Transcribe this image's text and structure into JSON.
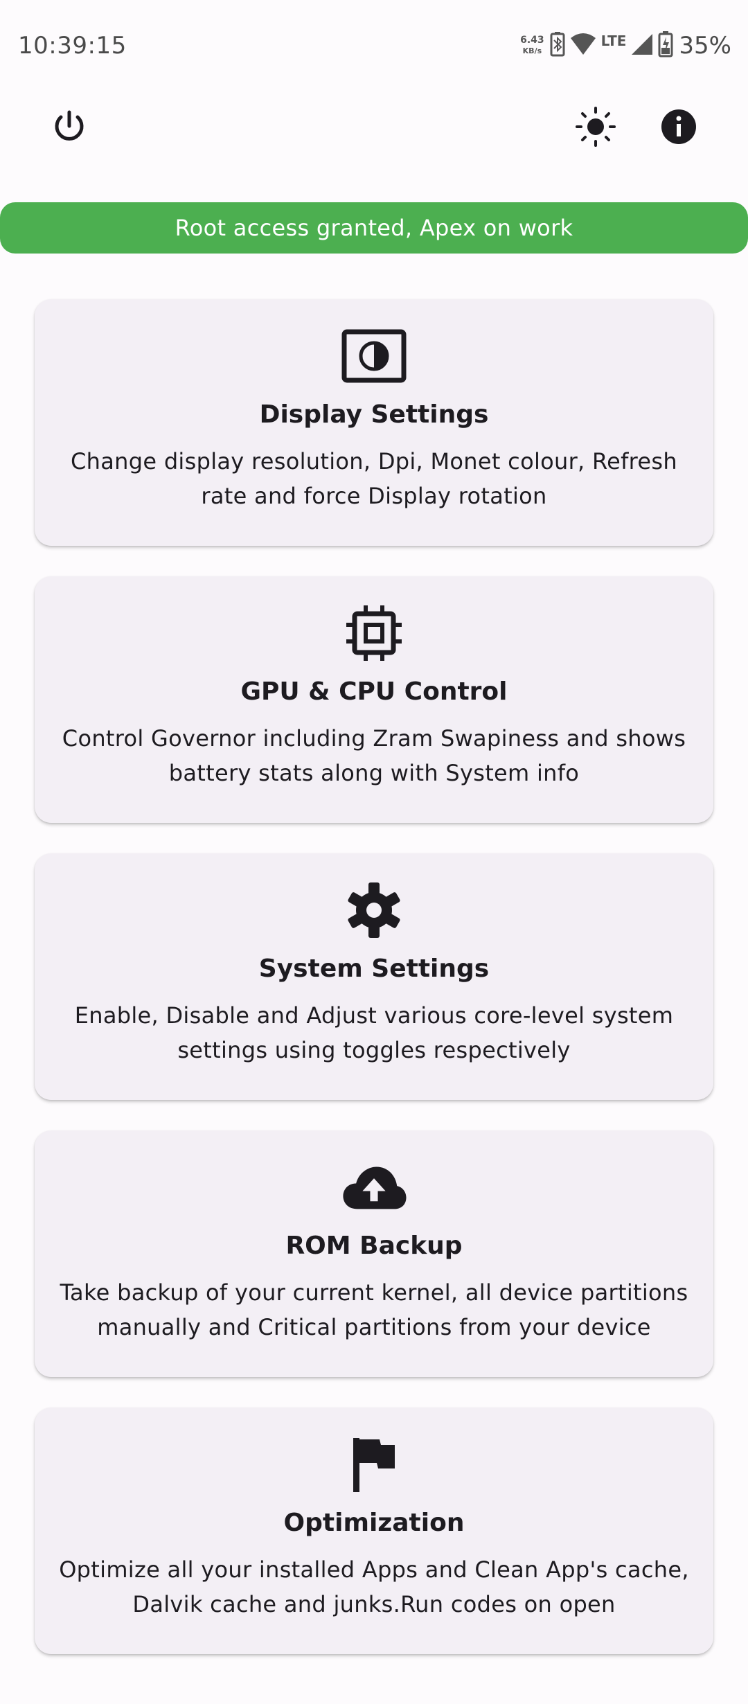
{
  "status_bar": {
    "time": "10:39:15",
    "net_speed_value": "6.43",
    "net_speed_unit": "KB/s",
    "network_type": "LTE",
    "battery_percent": "35%"
  },
  "top_bar": {
    "icons": [
      "power-icon",
      "brightness-icon",
      "info-icon"
    ]
  },
  "banner": {
    "text": "Root access granted, Apex on work",
    "color": "#4caf50"
  },
  "cards": [
    {
      "icon": "display-settings-icon",
      "title": "Display Settings",
      "description": "Change display resolution, Dpi, Monet colour, Refresh rate and force Display rotation"
    },
    {
      "icon": "chip-icon",
      "title": "GPU & CPU Control",
      "description": "Control Governor including Zram Swapiness and shows battery stats along with System info"
    },
    {
      "icon": "gear-icon",
      "title": "System Settings",
      "description": "Enable, Disable and Adjust various core-level system settings using toggles respectively"
    },
    {
      "icon": "cloud-upload-icon",
      "title": "ROM Backup",
      "description": "Take backup of your current kernel, all device partitions manually and Critical partitions from your device"
    },
    {
      "icon": "flag-icon",
      "title": "Optimization",
      "description": "Optimize all your installed Apps and Clean App's cache, Dalvik cache and junks.Run codes on open"
    }
  ]
}
